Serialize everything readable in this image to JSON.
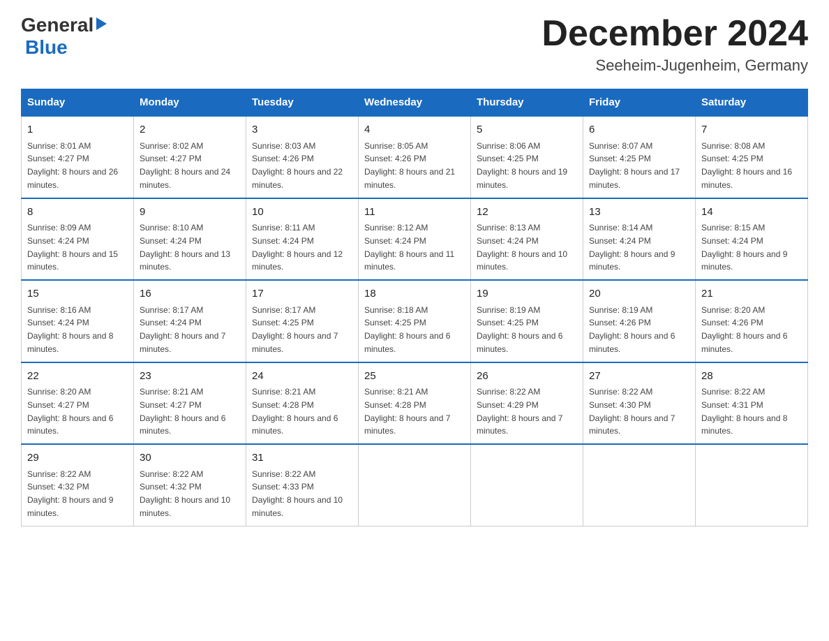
{
  "header": {
    "title": "December 2024",
    "subtitle": "Seeheim-Jugenheim, Germany",
    "logo_line1": "General",
    "logo_line2": "Blue"
  },
  "columns": [
    "Sunday",
    "Monday",
    "Tuesday",
    "Wednesday",
    "Thursday",
    "Friday",
    "Saturday"
  ],
  "weeks": [
    [
      {
        "day": "1",
        "sunrise": "8:01 AM",
        "sunset": "4:27 PM",
        "daylight": "8 hours and 26 minutes."
      },
      {
        "day": "2",
        "sunrise": "8:02 AM",
        "sunset": "4:27 PM",
        "daylight": "8 hours and 24 minutes."
      },
      {
        "day": "3",
        "sunrise": "8:03 AM",
        "sunset": "4:26 PM",
        "daylight": "8 hours and 22 minutes."
      },
      {
        "day": "4",
        "sunrise": "8:05 AM",
        "sunset": "4:26 PM",
        "daylight": "8 hours and 21 minutes."
      },
      {
        "day": "5",
        "sunrise": "8:06 AM",
        "sunset": "4:25 PM",
        "daylight": "8 hours and 19 minutes."
      },
      {
        "day": "6",
        "sunrise": "8:07 AM",
        "sunset": "4:25 PM",
        "daylight": "8 hours and 17 minutes."
      },
      {
        "day": "7",
        "sunrise": "8:08 AM",
        "sunset": "4:25 PM",
        "daylight": "8 hours and 16 minutes."
      }
    ],
    [
      {
        "day": "8",
        "sunrise": "8:09 AM",
        "sunset": "4:24 PM",
        "daylight": "8 hours and 15 minutes."
      },
      {
        "day": "9",
        "sunrise": "8:10 AM",
        "sunset": "4:24 PM",
        "daylight": "8 hours and 13 minutes."
      },
      {
        "day": "10",
        "sunrise": "8:11 AM",
        "sunset": "4:24 PM",
        "daylight": "8 hours and 12 minutes."
      },
      {
        "day": "11",
        "sunrise": "8:12 AM",
        "sunset": "4:24 PM",
        "daylight": "8 hours and 11 minutes."
      },
      {
        "day": "12",
        "sunrise": "8:13 AM",
        "sunset": "4:24 PM",
        "daylight": "8 hours and 10 minutes."
      },
      {
        "day": "13",
        "sunrise": "8:14 AM",
        "sunset": "4:24 PM",
        "daylight": "8 hours and 9 minutes."
      },
      {
        "day": "14",
        "sunrise": "8:15 AM",
        "sunset": "4:24 PM",
        "daylight": "8 hours and 9 minutes."
      }
    ],
    [
      {
        "day": "15",
        "sunrise": "8:16 AM",
        "sunset": "4:24 PM",
        "daylight": "8 hours and 8 minutes."
      },
      {
        "day": "16",
        "sunrise": "8:17 AM",
        "sunset": "4:24 PM",
        "daylight": "8 hours and 7 minutes."
      },
      {
        "day": "17",
        "sunrise": "8:17 AM",
        "sunset": "4:25 PM",
        "daylight": "8 hours and 7 minutes."
      },
      {
        "day": "18",
        "sunrise": "8:18 AM",
        "sunset": "4:25 PM",
        "daylight": "8 hours and 6 minutes."
      },
      {
        "day": "19",
        "sunrise": "8:19 AM",
        "sunset": "4:25 PM",
        "daylight": "8 hours and 6 minutes."
      },
      {
        "day": "20",
        "sunrise": "8:19 AM",
        "sunset": "4:26 PM",
        "daylight": "8 hours and 6 minutes."
      },
      {
        "day": "21",
        "sunrise": "8:20 AM",
        "sunset": "4:26 PM",
        "daylight": "8 hours and 6 minutes."
      }
    ],
    [
      {
        "day": "22",
        "sunrise": "8:20 AM",
        "sunset": "4:27 PM",
        "daylight": "8 hours and 6 minutes."
      },
      {
        "day": "23",
        "sunrise": "8:21 AM",
        "sunset": "4:27 PM",
        "daylight": "8 hours and 6 minutes."
      },
      {
        "day": "24",
        "sunrise": "8:21 AM",
        "sunset": "4:28 PM",
        "daylight": "8 hours and 6 minutes."
      },
      {
        "day": "25",
        "sunrise": "8:21 AM",
        "sunset": "4:28 PM",
        "daylight": "8 hours and 7 minutes."
      },
      {
        "day": "26",
        "sunrise": "8:22 AM",
        "sunset": "4:29 PM",
        "daylight": "8 hours and 7 minutes."
      },
      {
        "day": "27",
        "sunrise": "8:22 AM",
        "sunset": "4:30 PM",
        "daylight": "8 hours and 7 minutes."
      },
      {
        "day": "28",
        "sunrise": "8:22 AM",
        "sunset": "4:31 PM",
        "daylight": "8 hours and 8 minutes."
      }
    ],
    [
      {
        "day": "29",
        "sunrise": "8:22 AM",
        "sunset": "4:32 PM",
        "daylight": "8 hours and 9 minutes."
      },
      {
        "day": "30",
        "sunrise": "8:22 AM",
        "sunset": "4:32 PM",
        "daylight": "8 hours and 10 minutes."
      },
      {
        "day": "31",
        "sunrise": "8:22 AM",
        "sunset": "4:33 PM",
        "daylight": "8 hours and 10 minutes."
      },
      null,
      null,
      null,
      null
    ]
  ]
}
